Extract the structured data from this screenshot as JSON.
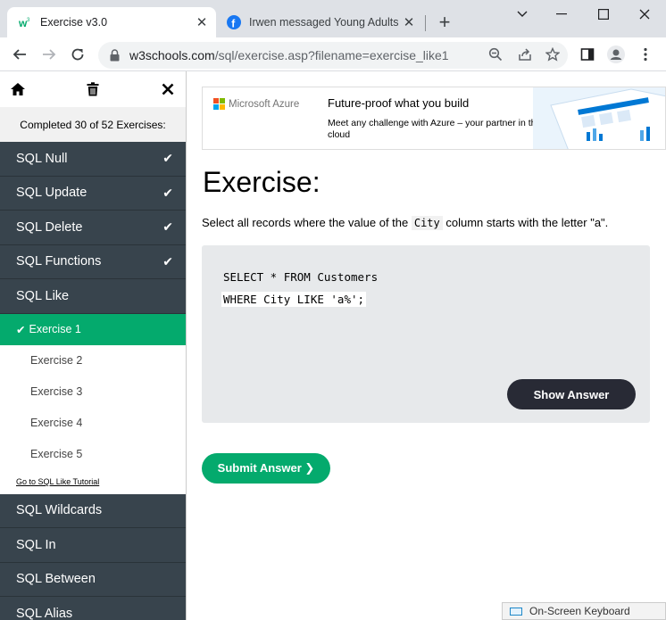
{
  "browser": {
    "active_tab": {
      "title": "Exercise v3.0"
    },
    "inactive_tab": {
      "title": "Irwen messaged Young Adults i"
    },
    "url_host": "w3schools.com",
    "url_path": "/sql/exercise.asp?filename=exercise_like1"
  },
  "sidebar": {
    "progress": "Completed 30 of 52 Exercises:",
    "topics_before": [
      {
        "label": "SQL Null",
        "done": "✔"
      },
      {
        "label": "SQL Update",
        "done": "✔"
      },
      {
        "label": "SQL Delete",
        "done": "✔"
      },
      {
        "label": "SQL Functions",
        "done": "✔"
      },
      {
        "label": "SQL Like",
        "done": ""
      }
    ],
    "exercises": [
      {
        "label": "Exercise 1",
        "tick": "✔"
      },
      {
        "label": "Exercise 2"
      },
      {
        "label": "Exercise 3"
      },
      {
        "label": "Exercise 4"
      },
      {
        "label": "Exercise 5"
      }
    ],
    "tutorial_link": "Go to SQL Like Tutorial",
    "topics_after": [
      {
        "label": "SQL Wildcards"
      },
      {
        "label": "SQL In"
      },
      {
        "label": "SQL Between"
      },
      {
        "label": "SQL Alias"
      }
    ]
  },
  "ad": {
    "brand": "Microsoft Azure",
    "headline": "Future-proof what you build",
    "sub": "Meet any challenge with Azure – your partner in the cloud"
  },
  "main": {
    "title": "Exercise:",
    "instruction_pre": "Select all records where the value of the ",
    "instruction_code": "City",
    "instruction_post": " column starts with the letter \"a\".",
    "code_line1": "SELECT * FROM Customers",
    "code_line2": "WHERE City LIKE 'a%';",
    "show_answer": "Show Answer",
    "submit": "Submit Answer ❯"
  },
  "taskbar": {
    "osk_label": "On-Screen Keyboard"
  },
  "colors": {
    "green": "#04aa6d",
    "dark": "#38444d",
    "button_dark": "#282a35"
  }
}
